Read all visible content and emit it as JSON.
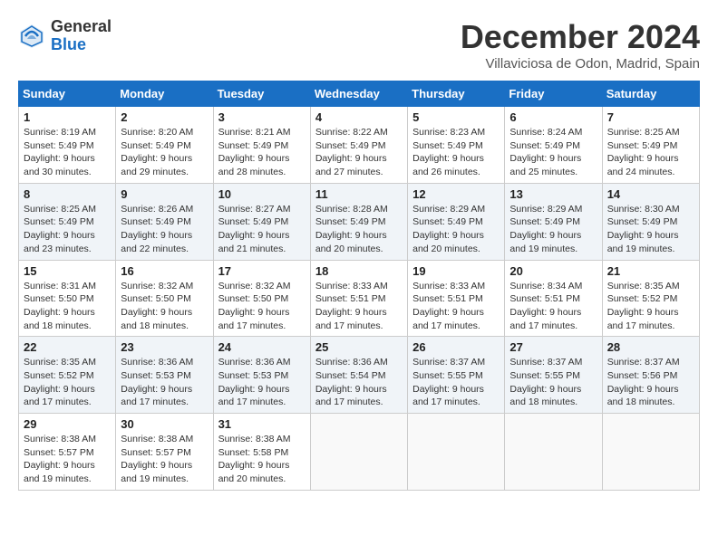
{
  "logo": {
    "general": "General",
    "blue": "Blue"
  },
  "header": {
    "month": "December 2024",
    "location": "Villaviciosa de Odon, Madrid, Spain"
  },
  "weekdays": [
    "Sunday",
    "Monday",
    "Tuesday",
    "Wednesday",
    "Thursday",
    "Friday",
    "Saturday"
  ],
  "weeks": [
    [
      {
        "day": "1",
        "info": "Sunrise: 8:19 AM\nSunset: 5:49 PM\nDaylight: 9 hours\nand 30 minutes."
      },
      {
        "day": "2",
        "info": "Sunrise: 8:20 AM\nSunset: 5:49 PM\nDaylight: 9 hours\nand 29 minutes."
      },
      {
        "day": "3",
        "info": "Sunrise: 8:21 AM\nSunset: 5:49 PM\nDaylight: 9 hours\nand 28 minutes."
      },
      {
        "day": "4",
        "info": "Sunrise: 8:22 AM\nSunset: 5:49 PM\nDaylight: 9 hours\nand 27 minutes."
      },
      {
        "day": "5",
        "info": "Sunrise: 8:23 AM\nSunset: 5:49 PM\nDaylight: 9 hours\nand 26 minutes."
      },
      {
        "day": "6",
        "info": "Sunrise: 8:24 AM\nSunset: 5:49 PM\nDaylight: 9 hours\nand 25 minutes."
      },
      {
        "day": "7",
        "info": "Sunrise: 8:25 AM\nSunset: 5:49 PM\nDaylight: 9 hours\nand 24 minutes."
      }
    ],
    [
      {
        "day": "8",
        "info": "Sunrise: 8:25 AM\nSunset: 5:49 PM\nDaylight: 9 hours\nand 23 minutes."
      },
      {
        "day": "9",
        "info": "Sunrise: 8:26 AM\nSunset: 5:49 PM\nDaylight: 9 hours\nand 22 minutes."
      },
      {
        "day": "10",
        "info": "Sunrise: 8:27 AM\nSunset: 5:49 PM\nDaylight: 9 hours\nand 21 minutes."
      },
      {
        "day": "11",
        "info": "Sunrise: 8:28 AM\nSunset: 5:49 PM\nDaylight: 9 hours\nand 20 minutes."
      },
      {
        "day": "12",
        "info": "Sunrise: 8:29 AM\nSunset: 5:49 PM\nDaylight: 9 hours\nand 20 minutes."
      },
      {
        "day": "13",
        "info": "Sunrise: 8:29 AM\nSunset: 5:49 PM\nDaylight: 9 hours\nand 19 minutes."
      },
      {
        "day": "14",
        "info": "Sunrise: 8:30 AM\nSunset: 5:49 PM\nDaylight: 9 hours\nand 19 minutes."
      }
    ],
    [
      {
        "day": "15",
        "info": "Sunrise: 8:31 AM\nSunset: 5:50 PM\nDaylight: 9 hours\nand 18 minutes."
      },
      {
        "day": "16",
        "info": "Sunrise: 8:32 AM\nSunset: 5:50 PM\nDaylight: 9 hours\nand 18 minutes."
      },
      {
        "day": "17",
        "info": "Sunrise: 8:32 AM\nSunset: 5:50 PM\nDaylight: 9 hours\nand 17 minutes."
      },
      {
        "day": "18",
        "info": "Sunrise: 8:33 AM\nSunset: 5:51 PM\nDaylight: 9 hours\nand 17 minutes."
      },
      {
        "day": "19",
        "info": "Sunrise: 8:33 AM\nSunset: 5:51 PM\nDaylight: 9 hours\nand 17 minutes."
      },
      {
        "day": "20",
        "info": "Sunrise: 8:34 AM\nSunset: 5:51 PM\nDaylight: 9 hours\nand 17 minutes."
      },
      {
        "day": "21",
        "info": "Sunrise: 8:35 AM\nSunset: 5:52 PM\nDaylight: 9 hours\nand 17 minutes."
      }
    ],
    [
      {
        "day": "22",
        "info": "Sunrise: 8:35 AM\nSunset: 5:52 PM\nDaylight: 9 hours\nand 17 minutes."
      },
      {
        "day": "23",
        "info": "Sunrise: 8:36 AM\nSunset: 5:53 PM\nDaylight: 9 hours\nand 17 minutes."
      },
      {
        "day": "24",
        "info": "Sunrise: 8:36 AM\nSunset: 5:53 PM\nDaylight: 9 hours\nand 17 minutes."
      },
      {
        "day": "25",
        "info": "Sunrise: 8:36 AM\nSunset: 5:54 PM\nDaylight: 9 hours\nand 17 minutes."
      },
      {
        "day": "26",
        "info": "Sunrise: 8:37 AM\nSunset: 5:55 PM\nDaylight: 9 hours\nand 17 minutes."
      },
      {
        "day": "27",
        "info": "Sunrise: 8:37 AM\nSunset: 5:55 PM\nDaylight: 9 hours\nand 18 minutes."
      },
      {
        "day": "28",
        "info": "Sunrise: 8:37 AM\nSunset: 5:56 PM\nDaylight: 9 hours\nand 18 minutes."
      }
    ],
    [
      {
        "day": "29",
        "info": "Sunrise: 8:38 AM\nSunset: 5:57 PM\nDaylight: 9 hours\nand 19 minutes."
      },
      {
        "day": "30",
        "info": "Sunrise: 8:38 AM\nSunset: 5:57 PM\nDaylight: 9 hours\nand 19 minutes."
      },
      {
        "day": "31",
        "info": "Sunrise: 8:38 AM\nSunset: 5:58 PM\nDaylight: 9 hours\nand 20 minutes."
      },
      null,
      null,
      null,
      null
    ]
  ]
}
